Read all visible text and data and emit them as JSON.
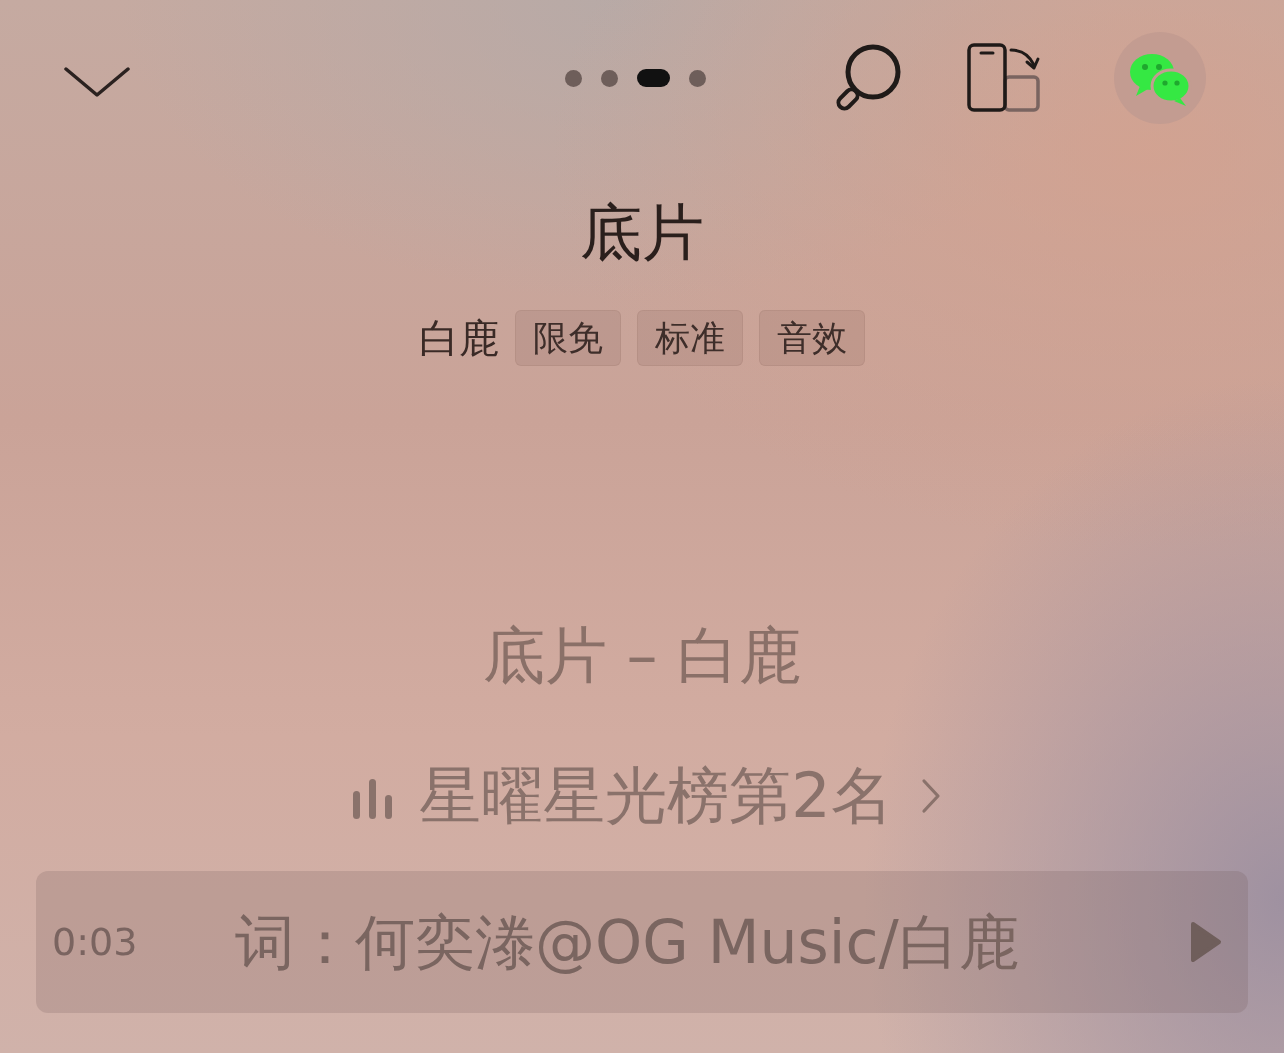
{
  "top_bar": {
    "page_dots": [
      {
        "selected": false
      },
      {
        "selected": false
      },
      {
        "selected": true
      },
      {
        "selected": false
      }
    ]
  },
  "song": {
    "title": "底片",
    "artist": "白鹿",
    "tags": [
      "限免",
      "标准",
      "音效"
    ]
  },
  "lyrics": {
    "current_line": "底片 – 白鹿"
  },
  "chart_rank": {
    "label": "星曜星光榜第2名"
  },
  "lyric_bar": {
    "time": "0:03",
    "text": "词：何奕漛@OG Music/白鹿"
  }
}
